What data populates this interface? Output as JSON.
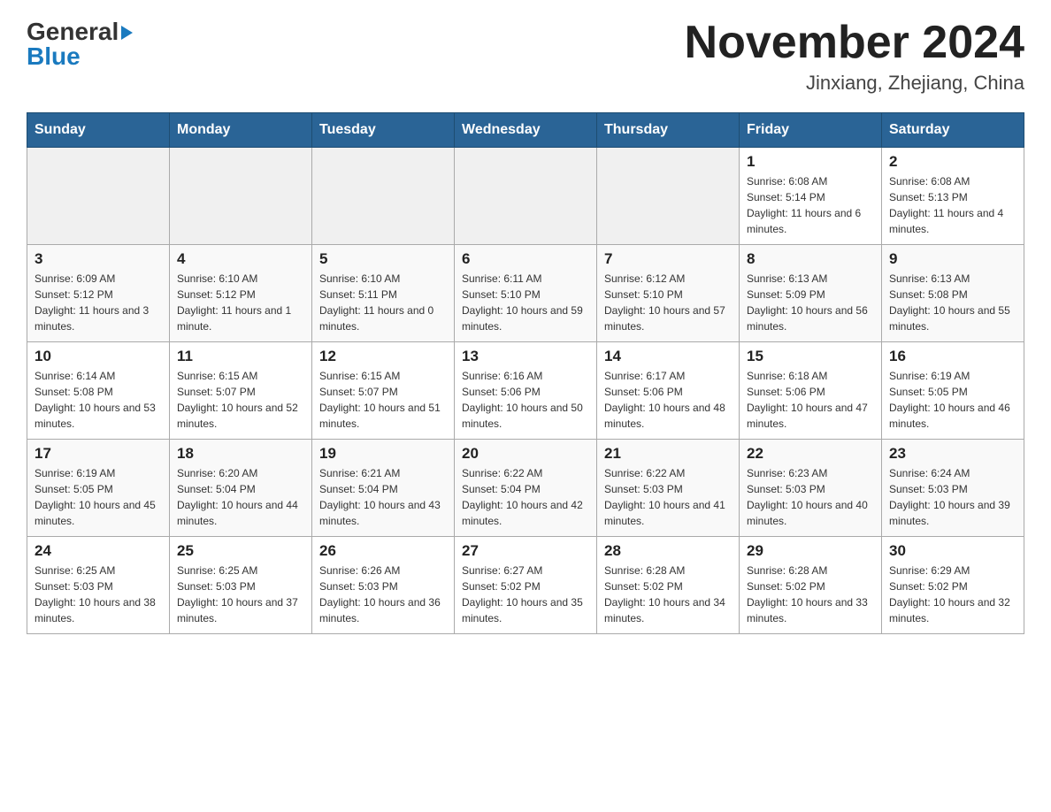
{
  "header": {
    "logo_general": "General",
    "logo_blue": "Blue",
    "month_title": "November 2024",
    "location": "Jinxiang, Zhejiang, China"
  },
  "days_of_week": [
    "Sunday",
    "Monday",
    "Tuesday",
    "Wednesday",
    "Thursday",
    "Friday",
    "Saturday"
  ],
  "weeks": [
    [
      {
        "day": "",
        "sunrise": "",
        "sunset": "",
        "daylight": ""
      },
      {
        "day": "",
        "sunrise": "",
        "sunset": "",
        "daylight": ""
      },
      {
        "day": "",
        "sunrise": "",
        "sunset": "",
        "daylight": ""
      },
      {
        "day": "",
        "sunrise": "",
        "sunset": "",
        "daylight": ""
      },
      {
        "day": "",
        "sunrise": "",
        "sunset": "",
        "daylight": ""
      },
      {
        "day": "1",
        "sunrise": "Sunrise: 6:08 AM",
        "sunset": "Sunset: 5:14 PM",
        "daylight": "Daylight: 11 hours and 6 minutes."
      },
      {
        "day": "2",
        "sunrise": "Sunrise: 6:08 AM",
        "sunset": "Sunset: 5:13 PM",
        "daylight": "Daylight: 11 hours and 4 minutes."
      }
    ],
    [
      {
        "day": "3",
        "sunrise": "Sunrise: 6:09 AM",
        "sunset": "Sunset: 5:12 PM",
        "daylight": "Daylight: 11 hours and 3 minutes."
      },
      {
        "day": "4",
        "sunrise": "Sunrise: 6:10 AM",
        "sunset": "Sunset: 5:12 PM",
        "daylight": "Daylight: 11 hours and 1 minute."
      },
      {
        "day": "5",
        "sunrise": "Sunrise: 6:10 AM",
        "sunset": "Sunset: 5:11 PM",
        "daylight": "Daylight: 11 hours and 0 minutes."
      },
      {
        "day": "6",
        "sunrise": "Sunrise: 6:11 AM",
        "sunset": "Sunset: 5:10 PM",
        "daylight": "Daylight: 10 hours and 59 minutes."
      },
      {
        "day": "7",
        "sunrise": "Sunrise: 6:12 AM",
        "sunset": "Sunset: 5:10 PM",
        "daylight": "Daylight: 10 hours and 57 minutes."
      },
      {
        "day": "8",
        "sunrise": "Sunrise: 6:13 AM",
        "sunset": "Sunset: 5:09 PM",
        "daylight": "Daylight: 10 hours and 56 minutes."
      },
      {
        "day": "9",
        "sunrise": "Sunrise: 6:13 AM",
        "sunset": "Sunset: 5:08 PM",
        "daylight": "Daylight: 10 hours and 55 minutes."
      }
    ],
    [
      {
        "day": "10",
        "sunrise": "Sunrise: 6:14 AM",
        "sunset": "Sunset: 5:08 PM",
        "daylight": "Daylight: 10 hours and 53 minutes."
      },
      {
        "day": "11",
        "sunrise": "Sunrise: 6:15 AM",
        "sunset": "Sunset: 5:07 PM",
        "daylight": "Daylight: 10 hours and 52 minutes."
      },
      {
        "day": "12",
        "sunrise": "Sunrise: 6:15 AM",
        "sunset": "Sunset: 5:07 PM",
        "daylight": "Daylight: 10 hours and 51 minutes."
      },
      {
        "day": "13",
        "sunrise": "Sunrise: 6:16 AM",
        "sunset": "Sunset: 5:06 PM",
        "daylight": "Daylight: 10 hours and 50 minutes."
      },
      {
        "day": "14",
        "sunrise": "Sunrise: 6:17 AM",
        "sunset": "Sunset: 5:06 PM",
        "daylight": "Daylight: 10 hours and 48 minutes."
      },
      {
        "day": "15",
        "sunrise": "Sunrise: 6:18 AM",
        "sunset": "Sunset: 5:06 PM",
        "daylight": "Daylight: 10 hours and 47 minutes."
      },
      {
        "day": "16",
        "sunrise": "Sunrise: 6:19 AM",
        "sunset": "Sunset: 5:05 PM",
        "daylight": "Daylight: 10 hours and 46 minutes."
      }
    ],
    [
      {
        "day": "17",
        "sunrise": "Sunrise: 6:19 AM",
        "sunset": "Sunset: 5:05 PM",
        "daylight": "Daylight: 10 hours and 45 minutes."
      },
      {
        "day": "18",
        "sunrise": "Sunrise: 6:20 AM",
        "sunset": "Sunset: 5:04 PM",
        "daylight": "Daylight: 10 hours and 44 minutes."
      },
      {
        "day": "19",
        "sunrise": "Sunrise: 6:21 AM",
        "sunset": "Sunset: 5:04 PM",
        "daylight": "Daylight: 10 hours and 43 minutes."
      },
      {
        "day": "20",
        "sunrise": "Sunrise: 6:22 AM",
        "sunset": "Sunset: 5:04 PM",
        "daylight": "Daylight: 10 hours and 42 minutes."
      },
      {
        "day": "21",
        "sunrise": "Sunrise: 6:22 AM",
        "sunset": "Sunset: 5:03 PM",
        "daylight": "Daylight: 10 hours and 41 minutes."
      },
      {
        "day": "22",
        "sunrise": "Sunrise: 6:23 AM",
        "sunset": "Sunset: 5:03 PM",
        "daylight": "Daylight: 10 hours and 40 minutes."
      },
      {
        "day": "23",
        "sunrise": "Sunrise: 6:24 AM",
        "sunset": "Sunset: 5:03 PM",
        "daylight": "Daylight: 10 hours and 39 minutes."
      }
    ],
    [
      {
        "day": "24",
        "sunrise": "Sunrise: 6:25 AM",
        "sunset": "Sunset: 5:03 PM",
        "daylight": "Daylight: 10 hours and 38 minutes."
      },
      {
        "day": "25",
        "sunrise": "Sunrise: 6:25 AM",
        "sunset": "Sunset: 5:03 PM",
        "daylight": "Daylight: 10 hours and 37 minutes."
      },
      {
        "day": "26",
        "sunrise": "Sunrise: 6:26 AM",
        "sunset": "Sunset: 5:03 PM",
        "daylight": "Daylight: 10 hours and 36 minutes."
      },
      {
        "day": "27",
        "sunrise": "Sunrise: 6:27 AM",
        "sunset": "Sunset: 5:02 PM",
        "daylight": "Daylight: 10 hours and 35 minutes."
      },
      {
        "day": "28",
        "sunrise": "Sunrise: 6:28 AM",
        "sunset": "Sunset: 5:02 PM",
        "daylight": "Daylight: 10 hours and 34 minutes."
      },
      {
        "day": "29",
        "sunrise": "Sunrise: 6:28 AM",
        "sunset": "Sunset: 5:02 PM",
        "daylight": "Daylight: 10 hours and 33 minutes."
      },
      {
        "day": "30",
        "sunrise": "Sunrise: 6:29 AM",
        "sunset": "Sunset: 5:02 PM",
        "daylight": "Daylight: 10 hours and 32 minutes."
      }
    ]
  ]
}
